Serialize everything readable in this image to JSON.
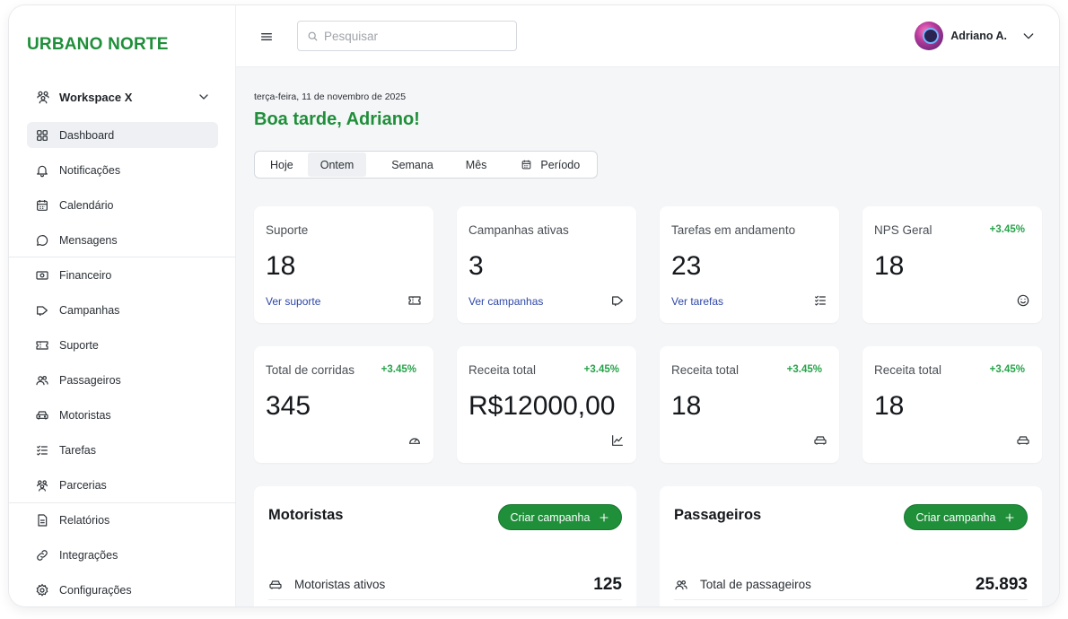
{
  "brand": "URBANO NORTE",
  "workspace": {
    "label": "Workspace X"
  },
  "sidebar": {
    "items": [
      {
        "label": "Dashboard",
        "icon": "grid-icon",
        "active": true
      },
      {
        "label": "Notificações",
        "icon": "bell-icon"
      },
      {
        "label": "Calendário",
        "icon": "calendar-icon"
      },
      {
        "label": "Mensagens",
        "icon": "message-icon"
      },
      {
        "label": "Financeiro",
        "icon": "cash-icon"
      },
      {
        "label": "Campanhas",
        "icon": "megaphone-icon"
      },
      {
        "label": "Suporte",
        "icon": "ticket-icon"
      },
      {
        "label": "Passageiros",
        "icon": "users-icon"
      },
      {
        "label": "Motoristas",
        "icon": "car-icon"
      },
      {
        "label": "Tarefas",
        "icon": "checklist-icon"
      },
      {
        "label": "Parcerias",
        "icon": "team-icon"
      },
      {
        "label": "Relatórios",
        "icon": "report-icon"
      },
      {
        "label": "Integrações",
        "icon": "link-icon"
      },
      {
        "label": "Configurações",
        "icon": "gear-icon"
      }
    ]
  },
  "topbar": {
    "search_placeholder": "Pesquisar",
    "user_name": "Adriano A."
  },
  "main": {
    "date": "terça-feira, 11 de novembro de 2025",
    "greeting": "Boa tarde, Adriano!",
    "periods": [
      "Hoje",
      "Ontem",
      "Semana",
      "Mês",
      "Período"
    ],
    "active_period": "Ontem"
  },
  "cards": [
    {
      "label": "Suporte",
      "value": "18",
      "link": "Ver suporte",
      "icon": "ticket-icon"
    },
    {
      "label": "Campanhas ativas",
      "value": "3",
      "link": "Ver campanhas",
      "icon": "megaphone-icon"
    },
    {
      "label": "Tarefas em andamento",
      "value": "23",
      "link": "Ver tarefas",
      "icon": "checklist-icon"
    },
    {
      "label": "NPS Geral",
      "value": "18",
      "delta": "+3.45%",
      "icon": "smile-icon"
    },
    {
      "label": "Total de corridas",
      "value": "345",
      "delta": "+3.45%",
      "icon": "speedometer-icon"
    },
    {
      "label": "Receita total",
      "value": "R$12000,00",
      "delta": "+3.45%",
      "icon": "trend-chart-icon"
    },
    {
      "label": "Receita total",
      "value": "18",
      "delta": "+3.45%",
      "icon": "car-icon"
    },
    {
      "label": "Receita total",
      "value": "18",
      "delta": "+3.45%",
      "icon": "car-icon"
    }
  ],
  "panels": [
    {
      "title": "Motoristas",
      "button": "Criar campanha",
      "row_label": "Motoristas ativos",
      "row_value": "125",
      "row_icon": "car-icon"
    },
    {
      "title": "Passageiros",
      "button": "Criar campanha",
      "row_label": "Total de passageiros",
      "row_value": "25.893",
      "row_icon": "users-icon"
    }
  ],
  "colors": {
    "brand_green": "#1f8f3a",
    "delta_green": "#27a34a",
    "link_blue": "#2e47a8"
  }
}
